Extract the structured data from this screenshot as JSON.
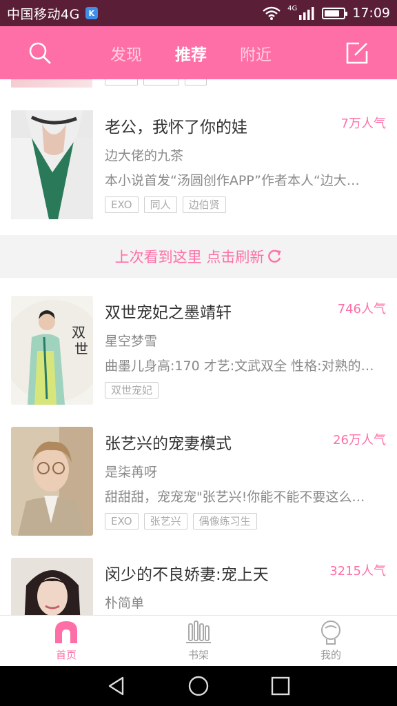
{
  "status_bar": {
    "carrier": "中国移动4G",
    "k_badge": "K",
    "net_label": "4G",
    "time": "17:09",
    "battery_level": 0.8
  },
  "header": {
    "tabs": [
      {
        "label": "发现",
        "active": false
      },
      {
        "label": "推荐",
        "active": true
      },
      {
        "label": "附近",
        "active": false
      }
    ],
    "icons": {
      "left": "search-icon",
      "right": "edit-icon"
    },
    "color": "#ff6fa7"
  },
  "feed": {
    "refresh_banner": "上次看到这里 点击刷新",
    "books": [
      {
        "title": "老公，我怀了你的娃",
        "popularity": "7万人气",
        "author": "边大佬的九茶",
        "desc": "本小说首发“汤圆创作APP”作者本人“边大…",
        "tags": [
          "EXO",
          "同人",
          "边伯贤"
        ]
      },
      {
        "title": "双世宠妃之墨靖轩",
        "popularity": "746人气",
        "author": "星空梦雪",
        "desc": "曲墨儿身高:170 才艺:文武双全 性格:对熟的…",
        "tags": [
          "双世宠妃"
        ]
      },
      {
        "title": "张艺兴的宠妻模式",
        "popularity": "26万人气",
        "author": "是柒苒呀",
        "desc": "甜甜甜，宠宠宠\"张艺兴!你能不能不要这么…",
        "tags": [
          "EXO",
          "张艺兴",
          "偶像练习生"
        ]
      },
      {
        "title": "闵少的不良娇妻:宠上天",
        "popularity": "3215人气",
        "author": "朴简单",
        "desc": "",
        "tags": []
      }
    ]
  },
  "bottom_nav": [
    {
      "label": "首页",
      "icon": "home-icon",
      "active": true
    },
    {
      "label": "书架",
      "icon": "bookshelf-icon",
      "active": false
    },
    {
      "label": "我的",
      "icon": "profile-icon",
      "active": false
    }
  ],
  "accent_color": "#ff6fa7"
}
